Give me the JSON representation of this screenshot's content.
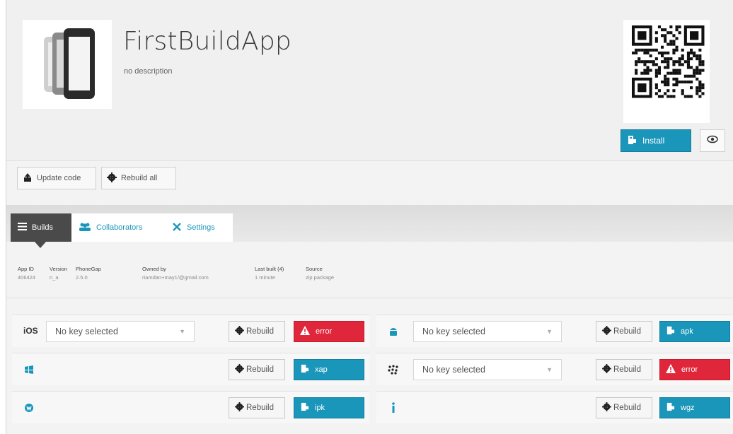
{
  "app": {
    "title": "FirstBuildApp",
    "description": "no description"
  },
  "header_actions": {
    "install_label": "Install"
  },
  "toolbar": {
    "update_code_label": "Update code",
    "rebuild_all_label": "Rebuild all"
  },
  "tabs": [
    {
      "label": "Builds",
      "icon": "list-icon",
      "active": true
    },
    {
      "label": "Collaborators",
      "icon": "users-icon",
      "active": false
    },
    {
      "label": "Settings",
      "icon": "tools-icon",
      "active": false
    }
  ],
  "info": [
    {
      "key": "App ID",
      "value": "406424"
    },
    {
      "key": "Version",
      "value": "n_a"
    },
    {
      "key": "PhoneGap",
      "value": "2.5.0"
    },
    {
      "key": "Owned by",
      "value": "riamdan+may1/@gmail.com"
    },
    {
      "key": "Last built (4)",
      "value": "1 minute"
    },
    {
      "key": "Source",
      "value": "zip package"
    }
  ],
  "platforms": [
    {
      "name": "iOS",
      "label": "iOS",
      "icon": "",
      "key_select": "No key selected",
      "rebuild_label": "Rebuild",
      "status": "error",
      "status_type": "error"
    },
    {
      "name": "android",
      "label": "",
      "icon": "android-icon",
      "key_select": "No key selected",
      "rebuild_label": "Rebuild",
      "status": "apk",
      "status_type": "ok"
    },
    {
      "name": "windows-phone",
      "label": "",
      "icon": "windows-icon",
      "key_select": null,
      "rebuild_label": "Rebuild",
      "status": "xap",
      "status_type": "ok"
    },
    {
      "name": "blackberry",
      "label": "",
      "icon": "blackberry-icon",
      "key_select": "No key selected",
      "rebuild_label": "Rebuild",
      "status": "error",
      "status_type": "error"
    },
    {
      "name": "webos",
      "label": "",
      "icon": "webos-icon",
      "key_select": null,
      "rebuild_label": "Rebuild",
      "status": "ipk",
      "status_type": "ok"
    },
    {
      "name": "symbian",
      "label": "",
      "icon": "info-icon",
      "key_select": null,
      "rebuild_label": "Rebuild",
      "status": "wgz",
      "status_type": "ok"
    }
  ],
  "colors": {
    "accent": "#1b96bb",
    "error": "#e0263a",
    "tab_active": "#4a4a4a"
  }
}
